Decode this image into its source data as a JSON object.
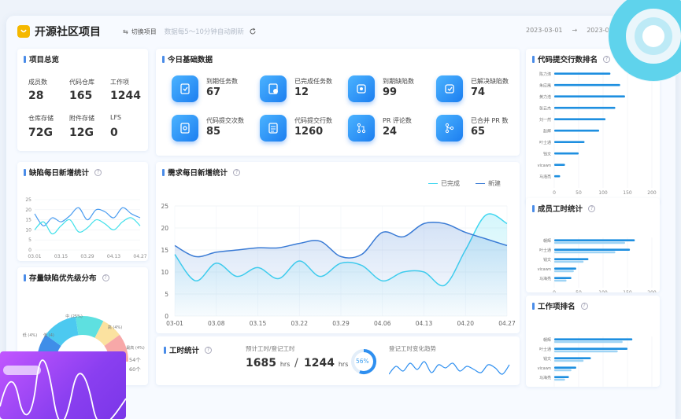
{
  "header": {
    "title": "开源社区项目",
    "switch_label": "切换项目",
    "refresh_note": "数据每5～10分钟自动刷新",
    "date_start": "2023-03-01",
    "date_arrow": "→",
    "date_end": "2023-0"
  },
  "overview": {
    "title": "项目总览",
    "items": [
      {
        "label": "成员数",
        "value": "28"
      },
      {
        "label": "代码仓库",
        "value": "165"
      },
      {
        "label": "工作项",
        "value": "1244"
      },
      {
        "label": "仓库存储",
        "value": "72G"
      },
      {
        "label": "附件存储",
        "value": "12G"
      },
      {
        "label": "LFS",
        "value": "0"
      }
    ]
  },
  "today": {
    "title": "今日基础数据",
    "tiles": [
      {
        "label": "到期任务数",
        "value": "67",
        "icon": "task-icon"
      },
      {
        "label": "已完成任务数",
        "value": "12",
        "icon": "task-done-icon"
      },
      {
        "label": "到期缺陷数",
        "value": "99",
        "icon": "bug-icon"
      },
      {
        "label": "已解决缺陷数",
        "value": "74",
        "icon": "bug-fixed-icon"
      },
      {
        "label": "代码提交次数",
        "value": "85",
        "icon": "commit-icon"
      },
      {
        "label": "代码提交行数",
        "value": "1260",
        "icon": "code-lines-icon"
      },
      {
        "label": "PR 评论数",
        "value": "24",
        "icon": "pr-comment-icon"
      },
      {
        "label": "已合并 PR 数",
        "value": "65",
        "icon": "pr-merged-icon"
      }
    ]
  },
  "defects_daily": {
    "title": "缺陷每日新增统计",
    "chart_data": {
      "type": "line",
      "x": [
        "03.01",
        "03.15",
        "03.29",
        "04.13",
        "04.27"
      ],
      "ylim": [
        0,
        25
      ],
      "yticks": [
        "0",
        "5",
        "10",
        "15",
        "20",
        "25"
      ],
      "series": [
        {
          "values": [
            18,
            12,
            16,
            14,
            17,
            21,
            15,
            20,
            19,
            16,
            21,
            18,
            16
          ]
        },
        {
          "values": [
            10,
            14,
            8,
            12,
            15,
            9,
            11,
            15,
            13,
            10,
            14,
            16,
            12
          ]
        }
      ]
    }
  },
  "priority": {
    "title": "存量缺陷优先级分布",
    "labels": [
      "低 (4)",
      "中 (25%)",
      "低 (4%)",
      "高 (4%)",
      "最高 (4%)"
    ],
    "counts": [
      "54个",
      "60个"
    ],
    "chart_data": {
      "type": "pie",
      "values": [
        20,
        25,
        20,
        15,
        20
      ],
      "colors": [
        "#3f8ee8",
        "#4cc9f0",
        "#5ee0e0",
        "#fbe2a0",
        "#f7a8a8"
      ]
    }
  },
  "demand": {
    "title": "需求每日新增统计",
    "legend_done": "已完成",
    "legend_new": "新建",
    "chart_data": {
      "type": "area",
      "x": [
        "03-01",
        "03.08",
        "03.15",
        "03.22",
        "03.29",
        "04.06",
        "04.13",
        "04.20",
        "04.27"
      ],
      "ylim": [
        0,
        25
      ],
      "yticks": [
        "0",
        "5",
        "10",
        "15",
        "20",
        "25"
      ],
      "series": [
        {
          "name": "已完成",
          "color": "#3fd6f0",
          "values": [
            14,
            8,
            12,
            9,
            11,
            8.5,
            12.5,
            9,
            12,
            11.5,
            8,
            10,
            10,
            7,
            15,
            23,
            21
          ]
        },
        {
          "name": "新建",
          "color": "#3a7bd5",
          "values": [
            16,
            13.5,
            14.5,
            15,
            15.5,
            15.5,
            16.5,
            17,
            13.5,
            14,
            19,
            18,
            21,
            21,
            19,
            17.5,
            16
          ]
        }
      ]
    }
  },
  "work_hours": {
    "title": "工时统计",
    "subtitle": "预计工时/登记工时",
    "estimated": "1685",
    "registered": "1244",
    "unit": "hrs",
    "separator": "/",
    "ratio": "56%",
    "ratio_value": 0.56,
    "trend_title": "登记工时变化趋势"
  },
  "code_rank": {
    "title": "代码提交行数排名",
    "people": [
      "陈力涛",
      "朱应禺",
      "黄力浩",
      "张云杰",
      "刘一然",
      "赵辉",
      "叶士通",
      "钱文",
      "vicawn",
      "马海亮"
    ],
    "xticks": [
      "0",
      "50",
      "100",
      "150",
      "200"
    ],
    "chart_data": {
      "type": "bar",
      "values": [
        115,
        135,
        145,
        125,
        105,
        92,
        62,
        50,
        22,
        12
      ],
      "xlim": [
        0,
        200
      ]
    }
  },
  "member_hours": {
    "title": "成员工时统计",
    "people": [
      "朝辉",
      "叶士通",
      "钱文",
      "vicawn",
      "马海亮"
    ],
    "xticks": [
      "0",
      "50",
      "100",
      "150",
      "200"
    ],
    "chart_data": {
      "type": "bar",
      "series": [
        {
          "values": [
            165,
            155,
            70,
            45,
            35
          ],
          "color": "#1e8fe0"
        },
        {
          "values": [
            145,
            125,
            60,
            40,
            25
          ],
          "color": "#9fd4f5"
        }
      ],
      "xlim": [
        0,
        200
      ]
    }
  },
  "work_rank": {
    "title": "工作项排名",
    "people": [
      "朝辉",
      "叶士通",
      "钱文",
      "vicawn",
      "马海亮"
    ],
    "xticks": [
      "0",
      "50",
      "100",
      "150",
      "200"
    ],
    "chart_data": {
      "type": "bar",
      "series": [
        {
          "values": [
            160,
            150,
            75,
            45,
            30
          ],
          "color": "#1e8fe0"
        },
        {
          "values": [
            140,
            130,
            60,
            35,
            22
          ],
          "color": "#9fd4f5"
        }
      ],
      "xlim": [
        0,
        200
      ]
    }
  }
}
